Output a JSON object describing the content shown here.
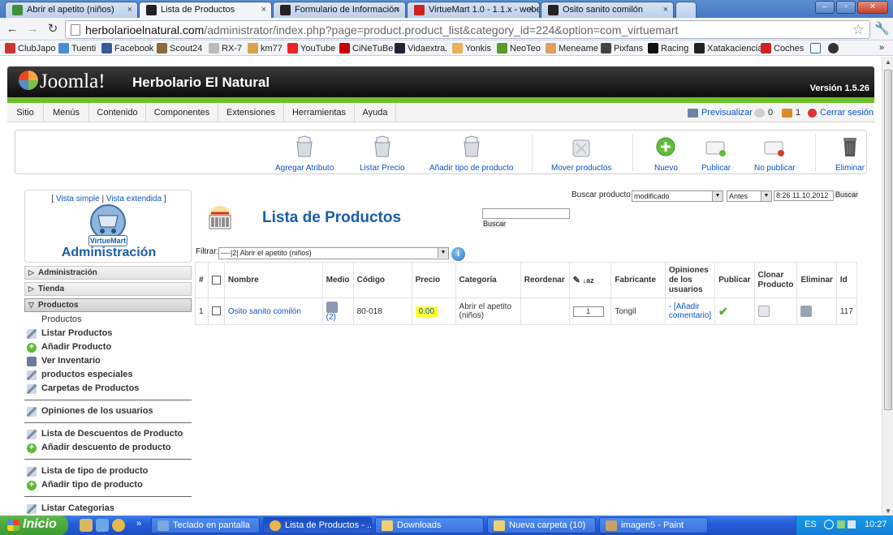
{
  "browser": {
    "tabs": [
      {
        "title": "Abrir el apetito (niños)",
        "close": "×",
        "favicon_color": "#3f8f3f"
      },
      {
        "title": "Lista de Productos",
        "close": "×",
        "favicon_color": "#222222"
      },
      {
        "title": "Formulario de Información",
        "close": "×",
        "favicon_color": "#222222"
      },
      {
        "title": "VirtueMart 1.0 - 1.1.x - webe",
        "close": "×",
        "favicon_color": "#cc2222"
      },
      {
        "title": "Osito sanito comilón",
        "close": "×",
        "favicon_color": "#222222"
      }
    ],
    "active_tab": 1,
    "url_host": "herbolarioelnatural.com",
    "url_path": "/administrator/index.php?page=product.product_list&category_id=224&option=com_virtuemart",
    "bookmarks": [
      "ClubJapo",
      "Tuenti",
      "Facebook",
      "Scout24",
      "RX-7",
      "km77",
      "YouTube",
      "CiNeTuBe",
      "Vidaextra.",
      "Yonkis",
      "NeoTeo",
      "Meneame",
      "Pixfans",
      "Racing",
      "Xatakaciencia",
      "Coches"
    ]
  },
  "header": {
    "logo_text": "Joomla!",
    "site_name": "Herbolario El Natural",
    "version": "Versión 1.5.26"
  },
  "menu": {
    "items": [
      "Sitio",
      "Menús",
      "Contenido",
      "Componentes",
      "Extensiones",
      "Herramientas",
      "Ayuda"
    ],
    "preview": "Previsualizar",
    "messages_count": "0",
    "users_count": "1",
    "logout": "Cerrar sesión"
  },
  "toolbar": {
    "buttons": [
      "Agregar Atributo",
      "Listar Precio",
      "Añadir tipo de producto",
      "Mover productos",
      "Nuevo",
      "Publicar",
      "No publicar",
      "Eliminar"
    ]
  },
  "sidebar": {
    "view_simple": "Vista simple",
    "separator": "|",
    "view_extended": "Vista extendida",
    "logo_text": "VirtueMart",
    "title": "Administración",
    "sections": [
      "Administración",
      "Tienda",
      "Productos"
    ],
    "items": [
      "Productos",
      "Listar Productos",
      "Añadir Producto",
      "Ver Inventario",
      "productos especiales",
      "Carpetas de Productos",
      "Opiniones de los usuarios",
      "Lista de Descuentos de Producto",
      "Añadir descuento de producto",
      "Lista de tipo de producto",
      "Añadir tipo de producto",
      "Listar Categorias"
    ]
  },
  "search": {
    "label": "Buscar producto",
    "mode": "modificado",
    "when": "Antes",
    "date": "8:26 11.10.2012",
    "button": "Buscar"
  },
  "page": {
    "title": "Lista de Productos",
    "search_button": "Buscar",
    "filter_label": "Filtrar:",
    "filter_value": "----|2| Abrir el apetito (niños)"
  },
  "table": {
    "headers": [
      "#",
      "",
      "Nombre",
      "Medio",
      "Código",
      "Precio",
      "Categoría",
      "Reordenar",
      "",
      "Fabricante",
      "Opiniones de los usuarios",
      "Publicar",
      "Clonar Producto",
      "Eliminar",
      "Id"
    ],
    "rows": [
      {
        "num": "1",
        "name": "Osito sanito comilón",
        "media_count": "(2)",
        "code": "80-018",
        "price": "0.00",
        "category": "Abrir el apetito (niños)",
        "order": "1",
        "manufacturer": "Tongil",
        "review": "- [Añadir comentario]",
        "id": "117"
      }
    ]
  },
  "taskbar": {
    "start": "Inicio",
    "tasks": [
      "Teclado en pantalla",
      "Lista de Productos - ...",
      "Downloads",
      "Nueva carpeta (10)",
      "imagen5 - Paint"
    ],
    "lang": "ES",
    "time": "10:27"
  }
}
